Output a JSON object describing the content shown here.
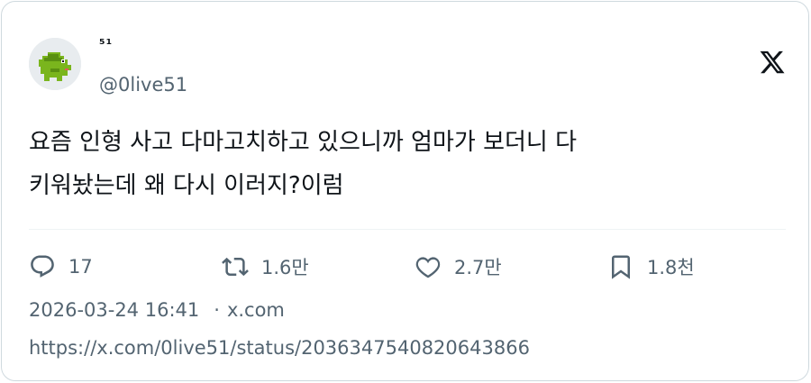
{
  "author": {
    "display_name": "⁵¹",
    "handle": "@0live51",
    "avatar_icon": "green-creature-avatar-icon"
  },
  "brand_icon": "x-logo-icon",
  "tweet": {
    "line1": "요즘 인형 사고 다마고치하고 있으니까 엄마가 보더니 다",
    "line2": "키워놨는데 왜 다시 이러지?이럼"
  },
  "actions": {
    "reply_count": "17",
    "retweet_count": "1.6만",
    "like_count": "2.7만",
    "bookmark_count": "1.8천"
  },
  "meta": {
    "timestamp": "2026-03-24 16:41",
    "separator": "·",
    "source": "x.com",
    "url": "https://x.com/0live51/status/2036347540820643866"
  },
  "colors": {
    "text_primary": "#0f1419",
    "text_secondary": "#536471",
    "border": "#cfd9de",
    "avatar_green": "#7ab51d"
  }
}
